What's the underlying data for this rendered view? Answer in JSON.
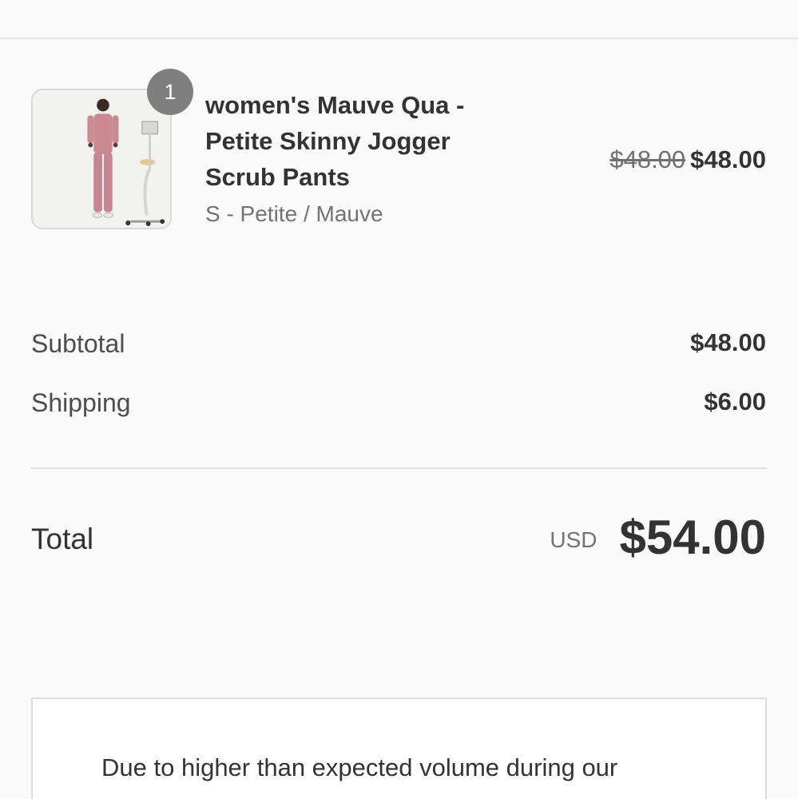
{
  "order_summary": {
    "line_items": [
      {
        "quantity": "1",
        "name": "women's Mauve Qua - Petite Skinny Jogger Scrub Pants",
        "variant": "S - Petite / Mauve",
        "original_price": "$48.00",
        "price": "$48.00",
        "image_icon": "product-photo"
      }
    ],
    "subtotal_label": "Subtotal",
    "subtotal_value": "$48.00",
    "shipping_label": "Shipping",
    "shipping_value": "$6.00",
    "total_label": "Total",
    "currency": "USD",
    "total_value": "$54.00"
  },
  "notice": {
    "text": "Due to higher than expected volume during our"
  },
  "colors": {
    "background": "#fafafa",
    "badge": "#7f7f7f",
    "text": "#333333",
    "muted": "#737373"
  }
}
